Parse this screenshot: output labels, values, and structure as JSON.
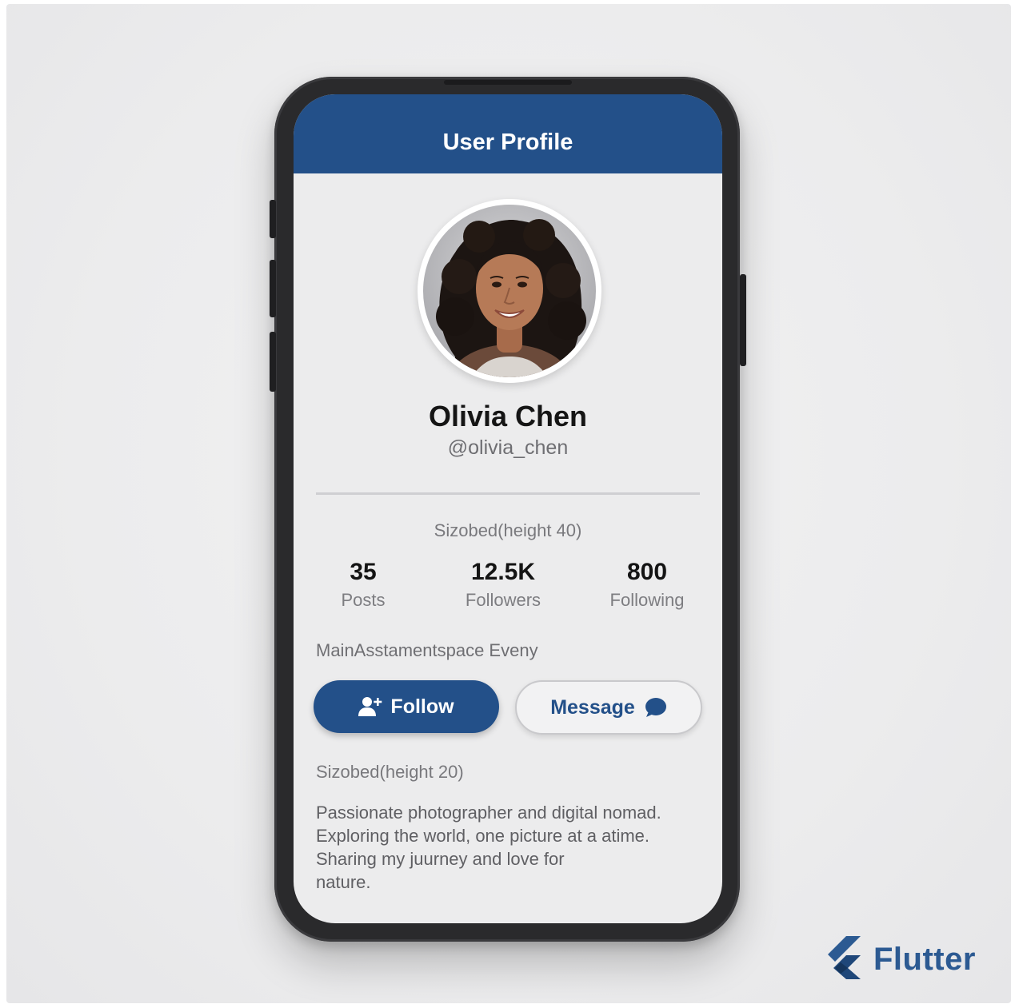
{
  "appbar": {
    "title": "User Profile"
  },
  "profile": {
    "name": "Olivia Chen",
    "handle": "@olivia_chen"
  },
  "layout_labels": {
    "sized_40": "Sizobed(height 40)",
    "main_axis": "MainAsstamentspace Eveny",
    "sized_20": "Sizobed(height 20)"
  },
  "stats": [
    {
      "value": "35",
      "label": "Posts"
    },
    {
      "value": "12.5K",
      "label": "Followers"
    },
    {
      "value": "800",
      "label": "Following"
    }
  ],
  "actions": {
    "follow_label": "Follow",
    "message_label": "Message"
  },
  "bio": {
    "lines": [
      "Passionate photographer and digital nomad.",
      "Exploring the world, one picture at a atime.",
      "Sharing my juurney and love for",
      "nature."
    ]
  },
  "brand": {
    "name": "Flutter"
  },
  "icons": {
    "follow": "person-add-icon",
    "message": "chat-bubble-icon",
    "brand": "flutter-logo-icon"
  },
  "colors": {
    "primary": "#235089",
    "background": "#ececed",
    "phone_frame": "#2a2a2c"
  }
}
